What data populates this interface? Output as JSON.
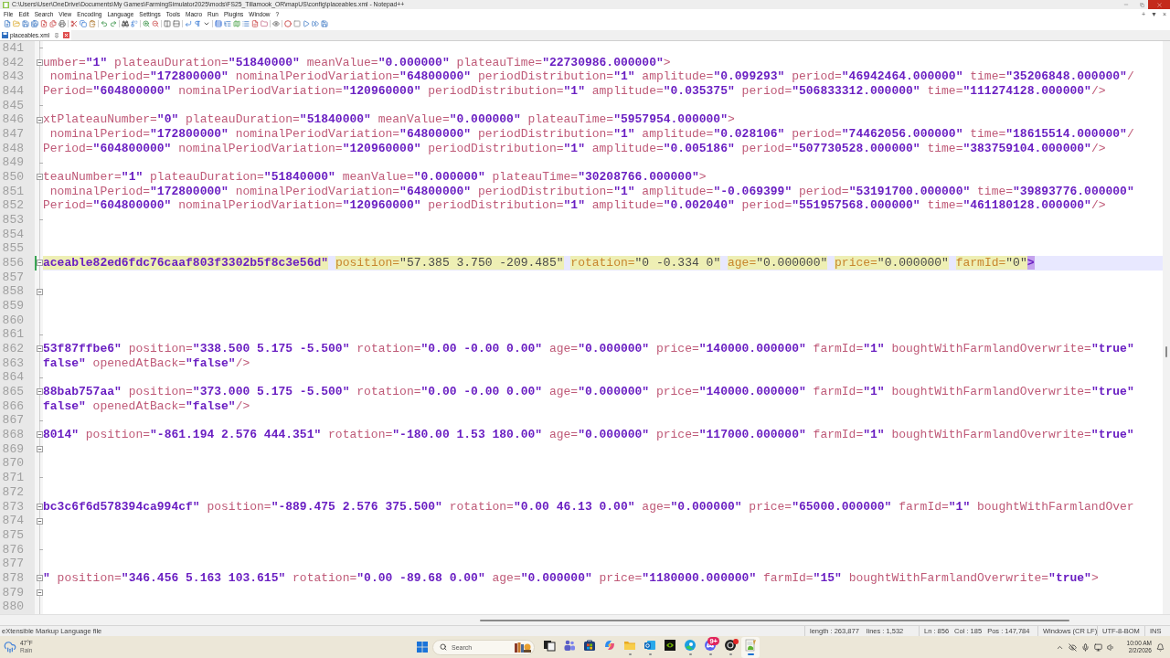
{
  "window": {
    "title": "C:\\Users\\User\\OneDrive\\Documents\\My Games\\FarmingSimulator2025\\mods\\FS25_Tillamook_OR\\mapUS\\config\\placeables.xml - Notepad++"
  },
  "menu": [
    "File",
    "Edit",
    "Search",
    "View",
    "Encoding",
    "Language",
    "Settings",
    "Tools",
    "Macro",
    "Run",
    "Plugins",
    "Window",
    "?"
  ],
  "tab_bar_controls": [
    "+",
    "▼",
    "×"
  ],
  "tabs": [
    {
      "label": "placeables.xml",
      "selected": true
    }
  ],
  "editor": {
    "lines": [
      {
        "number": "841",
        "selected": false,
        "changed": false,
        "brace_match": false,
        "fold_start": false,
        "fold_end": true
      },
      {
        "number": "842",
        "selected": false,
        "changed": false,
        "brace_match": false,
        "fold_start": true,
        "fold_end": false,
        "opens_in_value": false,
        "text": "umber=\"1\" plateauDuration=\"51840000\" meanValue=\"0.000000\" plateauTime=\"22730986.000000\">"
      },
      {
        "number": "843",
        "selected": false,
        "changed": false,
        "brace_match": false,
        "fold_start": false,
        "fold_end": false,
        "opens_in_value": false,
        "text": " nominalPeriod=\"172800000\" nominalPeriodVariation=\"64800000\" periodDistribution=\"1\" amplitude=\"0.099293\" period=\"46942464.000000\" time=\"35206848.000000\"/"
      },
      {
        "number": "844",
        "selected": false,
        "changed": false,
        "brace_match": false,
        "fold_start": false,
        "fold_end": false,
        "opens_in_value": false,
        "text": "Period=\"604800000\" nominalPeriodVariation=\"120960000\" periodDistribution=\"1\" amplitude=\"0.035375\" period=\"506833312.000000\" time=\"111274128.000000\"/>"
      },
      {
        "number": "845",
        "selected": false,
        "changed": false,
        "brace_match": false,
        "fold_start": false,
        "fold_end": true
      },
      {
        "number": "846",
        "selected": false,
        "changed": false,
        "brace_match": false,
        "fold_start": true,
        "fold_end": false,
        "opens_in_value": false,
        "text": "xtPlateauNumber=\"0\" plateauDuration=\"51840000\" meanValue=\"0.000000\" plateauTime=\"5957954.000000\">"
      },
      {
        "number": "847",
        "selected": false,
        "changed": false,
        "brace_match": false,
        "fold_start": false,
        "fold_end": false,
        "opens_in_value": false,
        "text": " nominalPeriod=\"172800000\" nominalPeriodVariation=\"64800000\" periodDistribution=\"1\" amplitude=\"0.028106\" period=\"74462056.000000\" time=\"18615514.000000\"/"
      },
      {
        "number": "848",
        "selected": false,
        "changed": false,
        "brace_match": false,
        "fold_start": false,
        "fold_end": false,
        "opens_in_value": false,
        "text": "Period=\"604800000\" nominalPeriodVariation=\"120960000\" periodDistribution=\"1\" amplitude=\"0.005186\" period=\"507730528.000000\" time=\"383759104.000000\"/>"
      },
      {
        "number": "849",
        "selected": false,
        "changed": false,
        "brace_match": false,
        "fold_start": false,
        "fold_end": true
      },
      {
        "number": "850",
        "selected": false,
        "changed": false,
        "brace_match": false,
        "fold_start": true,
        "fold_end": false,
        "opens_in_value": false,
        "text": "teauNumber=\"1\" plateauDuration=\"51840000\" meanValue=\"0.000000\" plateauTime=\"30208766.000000\">"
      },
      {
        "number": "851",
        "selected": false,
        "changed": false,
        "brace_match": false,
        "fold_start": false,
        "fold_end": false,
        "opens_in_value": false,
        "text": " nominalPeriod=\"172800000\" nominalPeriodVariation=\"64800000\" periodDistribution=\"1\" amplitude=\"-0.069399\" period=\"53191700.000000\" time=\"39893776.000000\""
      },
      {
        "number": "852",
        "selected": false,
        "changed": false,
        "brace_match": false,
        "fold_start": false,
        "fold_end": false,
        "opens_in_value": false,
        "text": "Period=\"604800000\" nominalPeriodVariation=\"120960000\" periodDistribution=\"1\" amplitude=\"0.002040\" period=\"551957568.000000\" time=\"461180128.000000\"/>"
      },
      {
        "number": "853",
        "selected": false,
        "changed": false,
        "brace_match": false,
        "fold_start": false,
        "fold_end": true
      },
      {
        "number": "854",
        "selected": false,
        "changed": false,
        "brace_match": false,
        "fold_start": false,
        "fold_end": false
      },
      {
        "number": "855",
        "selected": false,
        "changed": false,
        "brace_match": false,
        "fold_start": false,
        "fold_end": false
      },
      {
        "number": "856",
        "selected": true,
        "changed": true,
        "brace_match": true,
        "fold_start": true,
        "fold_end": false,
        "opens_in_value": true,
        "text": "aceable82ed6fdc76caaf803f3302b5f8c3e56d\" position=\"57.385 3.750 -209.485\" rotation=\"0 -0.334 0\" age=\"0.000000\" price=\"0.000000\" farmId=\"0\">"
      },
      {
        "number": "857",
        "selected": false,
        "changed": false,
        "brace_match": false,
        "fold_start": false,
        "fold_end": false
      },
      {
        "number": "858",
        "selected": false,
        "changed": false,
        "brace_match": false,
        "fold_start": true,
        "fold_end": false
      },
      {
        "number": "859",
        "selected": false,
        "changed": false,
        "brace_match": false,
        "fold_start": false,
        "fold_end": false
      },
      {
        "number": "860",
        "selected": false,
        "changed": false,
        "brace_match": false,
        "fold_start": false,
        "fold_end": false
      },
      {
        "number": "861",
        "selected": false,
        "changed": false,
        "brace_match": false,
        "fold_start": false,
        "fold_end": true
      },
      {
        "number": "862",
        "selected": false,
        "changed": false,
        "brace_match": false,
        "fold_start": true,
        "fold_end": false,
        "opens_in_value": true,
        "text": "53f87ffbe6\" position=\"338.500 5.175 -5.500\" rotation=\"0.00 -0.00 0.00\" age=\"0.000000\" price=\"140000.000000\" farmId=\"1\" boughtWithFarmlandOverwrite=\"true\""
      },
      {
        "number": "863",
        "selected": false,
        "changed": false,
        "brace_match": false,
        "fold_start": false,
        "fold_end": false,
        "opens_in_value": true,
        "text": "false\" openedAtBack=\"false\"/>"
      },
      {
        "number": "864",
        "selected": false,
        "changed": false,
        "brace_match": false,
        "fold_start": false,
        "fold_end": true
      },
      {
        "number": "865",
        "selected": false,
        "changed": false,
        "brace_match": false,
        "fold_start": true,
        "fold_end": false,
        "opens_in_value": true,
        "text": "88bab757aa\" position=\"373.000 5.175 -5.500\" rotation=\"0.00 -0.00 0.00\" age=\"0.000000\" price=\"140000.000000\" farmId=\"1\" boughtWithFarmlandOverwrite=\"true\""
      },
      {
        "number": "866",
        "selected": false,
        "changed": false,
        "brace_match": false,
        "fold_start": false,
        "fold_end": false,
        "opens_in_value": true,
        "text": "false\" openedAtBack=\"false\"/>"
      },
      {
        "number": "867",
        "selected": false,
        "changed": false,
        "brace_match": false,
        "fold_start": false,
        "fold_end": true
      },
      {
        "number": "868",
        "selected": false,
        "changed": false,
        "brace_match": false,
        "fold_start": true,
        "fold_end": false,
        "opens_in_value": true,
        "text": "8014\" position=\"-861.194 2.576 444.351\" rotation=\"-180.00 1.53 180.00\" age=\"0.000000\" price=\"117000.000000\" farmId=\"1\" boughtWithFarmlandOverwrite=\"true\""
      },
      {
        "number": "869",
        "selected": false,
        "changed": false,
        "brace_match": false,
        "fold_start": true,
        "fold_end": false
      },
      {
        "number": "870",
        "selected": false,
        "changed": false,
        "brace_match": false,
        "fold_start": false,
        "fold_end": false
      },
      {
        "number": "871",
        "selected": false,
        "changed": false,
        "brace_match": false,
        "fold_start": false,
        "fold_end": true
      },
      {
        "number": "872",
        "selected": false,
        "changed": false,
        "brace_match": false,
        "fold_start": false,
        "fold_end": false
      },
      {
        "number": "873",
        "selected": false,
        "changed": false,
        "brace_match": false,
        "fold_start": true,
        "fold_end": false,
        "opens_in_value": true,
        "text": "bc3c6f6d578394ca994cf\" position=\"-889.475 2.576 375.500\" rotation=\"0.00 46.13 0.00\" age=\"0.000000\" price=\"65000.000000\" farmId=\"1\" boughtWithFarmlandOver"
      },
      {
        "number": "874",
        "selected": false,
        "changed": false,
        "brace_match": false,
        "fold_start": true,
        "fold_end": false
      },
      {
        "number": "875",
        "selected": false,
        "changed": false,
        "brace_match": false,
        "fold_start": false,
        "fold_end": false
      },
      {
        "number": "876",
        "selected": false,
        "changed": false,
        "brace_match": false,
        "fold_start": false,
        "fold_end": true
      },
      {
        "number": "877",
        "selected": false,
        "changed": false,
        "brace_match": false,
        "fold_start": false,
        "fold_end": false
      },
      {
        "number": "878",
        "selected": false,
        "changed": false,
        "brace_match": false,
        "fold_start": true,
        "fold_end": false,
        "opens_in_value": true,
        "text": "\" position=\"346.456 5.163 103.615\" rotation=\"0.00 -89.68 0.00\" age=\"0.000000\" price=\"1180000.000000\" farmId=\"15\" boughtWithFarmlandOverwrite=\"true\">"
      },
      {
        "number": "879",
        "selected": false,
        "changed": false,
        "brace_match": false,
        "fold_start": true,
        "fold_end": false
      },
      {
        "number": "880",
        "selected": false,
        "changed": false,
        "brace_match": false,
        "fold_start": false,
        "fold_end": false
      }
    ]
  },
  "status_bar": {
    "file_type": "eXtensible Markup Language file",
    "length": "length : 263,877",
    "lines": "lines : 1,532",
    "ln": "Ln : 856",
    "col": "Col : 185",
    "pos": "Pos : 147,784",
    "eol": "Windows (CR LF)",
    "encoding": "UTF-8-BOM",
    "mode": "INS"
  },
  "taskbar": {
    "weather": {
      "temperature": "47°F",
      "condition": "Rain"
    },
    "search": {
      "placeholder": "Search"
    },
    "apps": [
      {
        "kind": "taskview",
        "running": false,
        "selected": false,
        "badge": false
      },
      {
        "kind": "people",
        "running": false,
        "selected": false,
        "badge": false
      },
      {
        "kind": "store",
        "running": false,
        "selected": false,
        "badge": false
      },
      {
        "kind": "swirl",
        "running": false,
        "selected": false,
        "badge": false
      },
      {
        "kind": "folder",
        "running": true,
        "selected": false,
        "badge": false
      },
      {
        "kind": "mail",
        "running": true,
        "selected": false,
        "badge": false
      },
      {
        "kind": "eye",
        "running": false,
        "selected": false,
        "badge": false
      },
      {
        "kind": "globe",
        "running": true,
        "selected": false,
        "badge": false
      },
      {
        "kind": "chat",
        "running": true,
        "selected": false,
        "badge": true,
        "badge_text": "9+"
      },
      {
        "kind": "orb",
        "running": true,
        "selected": false,
        "badge": true
      },
      {
        "kind": "notepad",
        "running": true,
        "selected": true,
        "badge": false
      }
    ],
    "clock": {
      "time": "10:00 AM",
      "date": "2/2/2026"
    }
  }
}
